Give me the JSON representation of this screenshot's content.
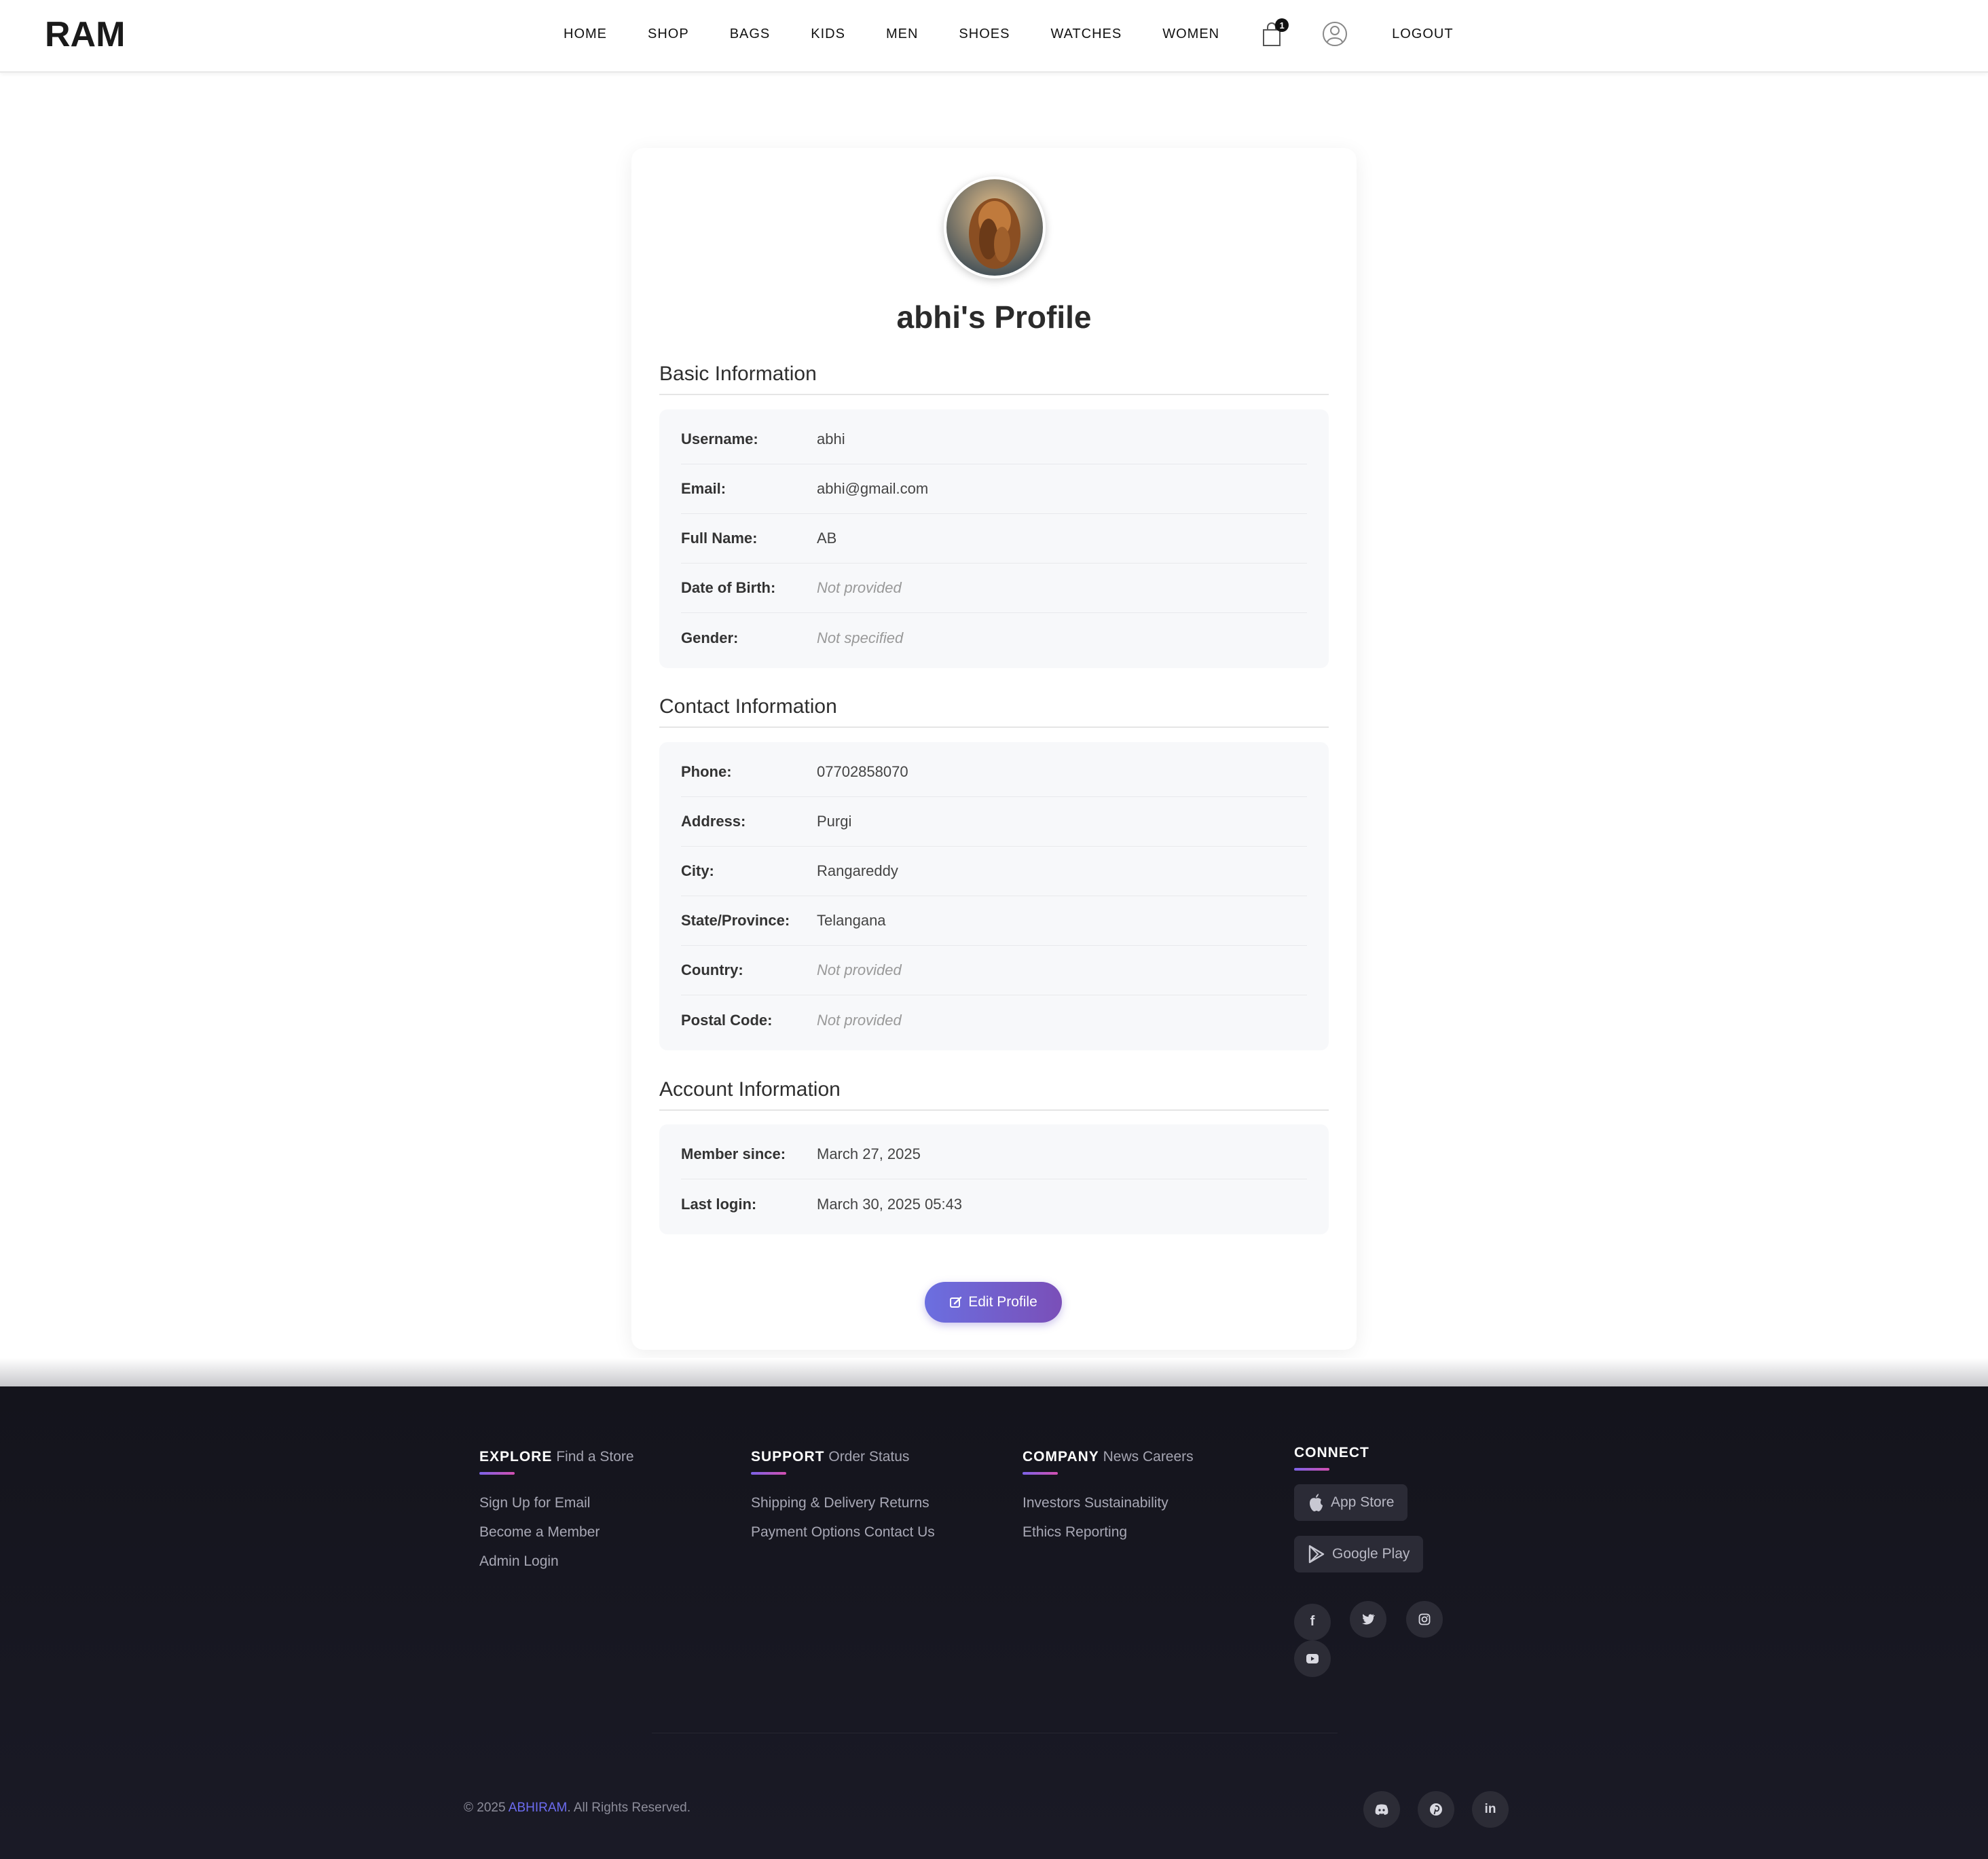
{
  "header": {
    "logo_text": "RAM",
    "nav": [
      "HOME",
      "SHOP",
      "BAGS",
      "KIDS",
      "MEN",
      "SHOES",
      "WATCHES",
      "WOMEN"
    ],
    "cart_count": "1",
    "logout": "LOGOUT"
  },
  "profile": {
    "title": "abhi's Profile",
    "basic": {
      "title": "Basic Information",
      "rows": [
        {
          "label": "Username:",
          "value": "abhi"
        },
        {
          "label": "Email:",
          "value": "abhi@gmail.com"
        },
        {
          "label": "Full Name:",
          "value": "AB"
        },
        {
          "label": "Date of Birth:",
          "value": "Not provided"
        },
        {
          "label": "Gender:",
          "value": "Not specified"
        }
      ]
    },
    "contact": {
      "title": "Contact Information",
      "rows": [
        {
          "label": "Phone:",
          "value": "07702858070"
        },
        {
          "label": "Address:",
          "value": "Purgi"
        },
        {
          "label": "City:",
          "value": "Rangareddy"
        },
        {
          "label": "State/Province:",
          "value": "Telangana"
        },
        {
          "label": "Country:",
          "value": "Not provided"
        },
        {
          "label": "Postal Code:",
          "value": "Not provided"
        }
      ]
    },
    "account": {
      "title": "Account Information",
      "rows": [
        {
          "label": "Member since:",
          "value": "March 27, 2025"
        },
        {
          "label": "Last login:",
          "value": "March 30, 2025 05:43"
        }
      ]
    },
    "edit_button": "Edit Profile"
  },
  "footer": {
    "explore": {
      "title": "EXPLORE",
      "sub": "Find a Store",
      "links": [
        "Sign Up for Email",
        "Become a Member",
        "Admin Login"
      ]
    },
    "support": {
      "title": "SUPPORT",
      "sub": "Order Status",
      "links": [
        "Shipping & Delivery Returns",
        "Payment Options Contact Us"
      ]
    },
    "company": {
      "title": "COMPANY",
      "sub": "News Careers",
      "links": [
        "Investors Sustainability",
        "Ethics Reporting"
      ]
    },
    "connect": {
      "title": "CONNECT",
      "app_store": "App Store",
      "google_play": "Google Play"
    },
    "copyright_pre": "© 2025",
    "copyright_brand": "ABHIRAM",
    "copyright_post": ". All Rights Reserved."
  },
  "colors": {
    "accent_start": "#6b6fe0",
    "accent_end": "#7a4fb8",
    "footer_bg": "#14141c"
  }
}
